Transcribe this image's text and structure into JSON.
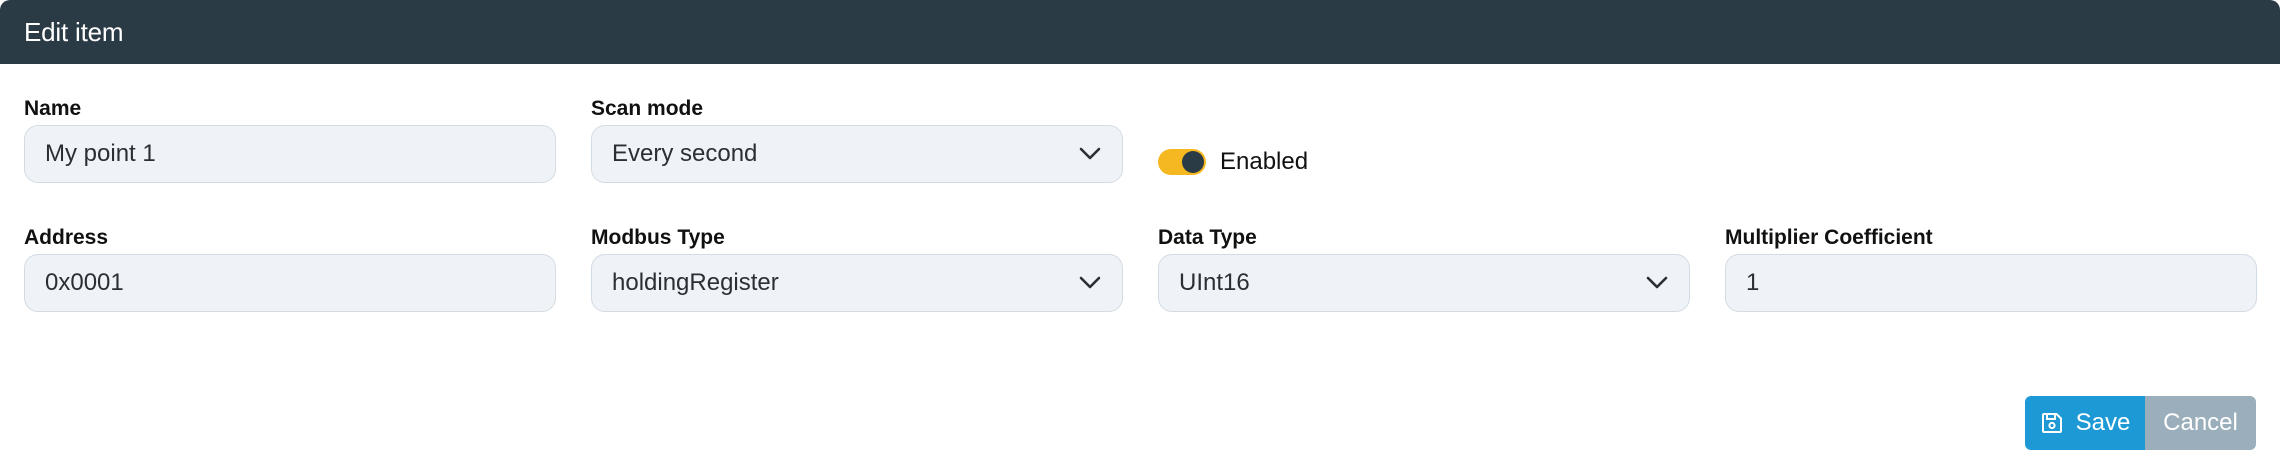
{
  "dialog": {
    "title": "Edit item"
  },
  "fields": {
    "name": {
      "label": "Name",
      "value": "My point 1"
    },
    "scan_mode": {
      "label": "Scan mode",
      "value": "Every second"
    },
    "enabled": {
      "label": "Enabled",
      "checked": true
    },
    "address": {
      "label": "Address",
      "value": "0x0001"
    },
    "modbus_type": {
      "label": "Modbus Type",
      "value": "holdingRegister"
    },
    "data_type": {
      "label": "Data Type",
      "value": "UInt16"
    },
    "multiplier": {
      "label": "Multiplier Coefficient",
      "value": "1"
    }
  },
  "actions": {
    "save_label": "Save",
    "cancel_label": "Cancel"
  },
  "colors": {
    "header_bg": "#2b3b45",
    "toggle_on": "#f5b820",
    "save_bg": "#1d9ad6",
    "cancel_bg": "#9aafbb"
  },
  "icons": {
    "save": "floppy-disk-icon",
    "dropdown": "chevron-down-icon"
  }
}
